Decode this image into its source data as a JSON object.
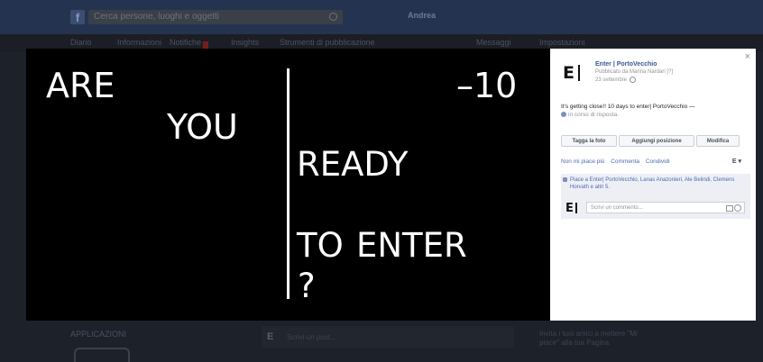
{
  "background_page": {
    "search_placeholder": "Cerca persone, luoghi e oggetti",
    "profile_name": "Andrea",
    "subnav": [
      "Diario",
      "Informazioni",
      "Notifiche",
      "Insights",
      "Strumenti di pubblicazione",
      "Messaggi",
      "Impostazioni"
    ],
    "left_section": "APPLICAZIONI",
    "mid_placeholder": "Scrivi un post...",
    "right_text": "Invita i tuoi amici a mettere \"Mi piace\" alla tua Pagina"
  },
  "photo": {
    "words": {
      "are": "ARE",
      "you": "YOU",
      "countdown": "–10",
      "ready": "READY",
      "to": "TO",
      "enter": "ENTER",
      "question": "?"
    }
  },
  "panel": {
    "close_label": "×",
    "page_name": "Enter | PortoVecchio",
    "posted_by": "Pubblicato da Marina Nardari [?]",
    "date": "23 settembre",
    "post_text": "It's getting close!! 10 days to enter| PortoVecchio —",
    "feeling": "in corso di risposta.",
    "buttons": {
      "tag": "Tagga la foto",
      "location": "Aggiungi posizione",
      "edit": "Modifica"
    },
    "actions": [
      "Non mi piace più",
      "Commenta",
      "Condividi"
    ],
    "page_switch": "E ▾",
    "likes_text": "Piace a Enter| PortoVecchio, Lanas Anazonieri, Ale Belindi, Clemens Horvath e altri 5.",
    "comment_placeholder": "Scrivi un commento...",
    "logo_letter": "E"
  }
}
